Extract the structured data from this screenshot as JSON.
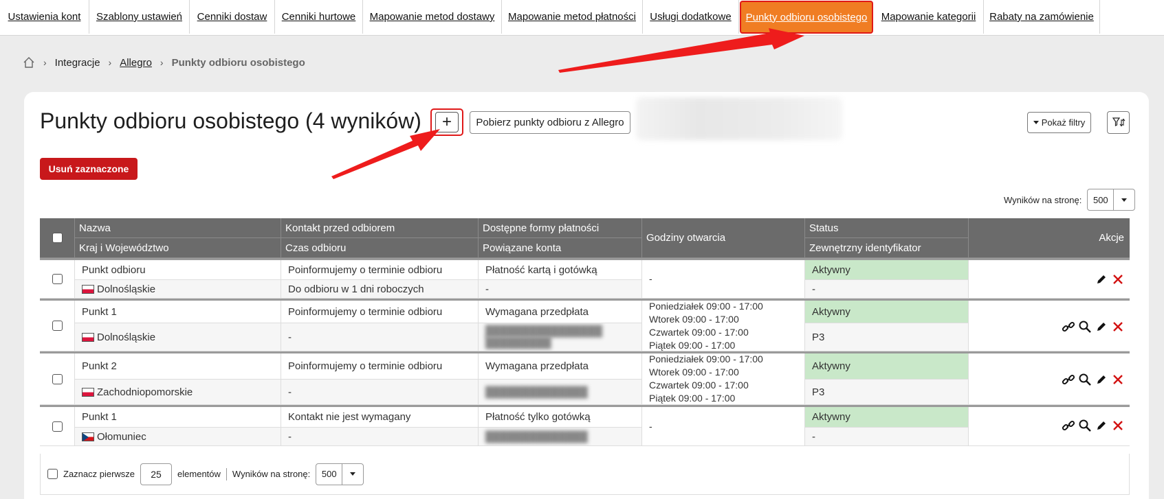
{
  "topnav": {
    "tabs": [
      {
        "label": "Ustawienia kont",
        "active": false
      },
      {
        "label": "Szablony ustawień",
        "active": false
      },
      {
        "label": "Cenniki dostaw",
        "active": false
      },
      {
        "label": "Cenniki hurtowe",
        "active": false
      },
      {
        "label": "Mapowanie metod dostawy",
        "active": false
      },
      {
        "label": "Mapowanie metod płatności",
        "active": false
      },
      {
        "label": "Usługi dodatkowe",
        "active": false
      },
      {
        "label": "Punkty odbioru osobistego",
        "active": true
      },
      {
        "label": "Mapowanie kategorii",
        "active": false
      },
      {
        "label": "Rabaty na zamówienie",
        "active": false
      }
    ]
  },
  "breadcrumb": {
    "home_icon": "home-icon",
    "items": [
      "Integracje",
      "Allegro",
      "Punkty odbioru osobistego"
    ]
  },
  "header": {
    "title": "Punkty odbioru osobistego (4 wyników)",
    "add_label": "+",
    "fetch_label": "Pobierz punkty odbioru z Allegro",
    "filters_label": "Pokaż filtry",
    "sort_icon": "filter-sort-icon"
  },
  "delete_selected_label": "Usuń zaznaczone",
  "per_page": {
    "label": "Wyników na stronę:",
    "value": "500"
  },
  "table": {
    "headers": {
      "name": "Nazwa",
      "country": "Kraj i Województwo",
      "contact": "Kontakt przed odbiorem",
      "pickup_time": "Czas odbioru",
      "payment": "Dostępne formy płatności",
      "accounts": "Powiązane konta",
      "hours": "Godziny otwarcia",
      "status": "Status",
      "external_id": "Zewnętrzny identyfikator",
      "actions": "Akcje"
    },
    "rows": [
      {
        "name": "Punkt odbioru",
        "region": "Dolnośląskie",
        "country_flag": "pl",
        "contact": "Poinformujemy o terminie odbioru",
        "pickup_time": "Do odbioru w 1 dni roboczych",
        "payment": "Płatność kartą i gotówką",
        "accounts": "-",
        "hours": [
          "-"
        ],
        "status": "Aktywny",
        "external_id": "-",
        "actions": [
          "pencil-icon",
          "delete-icon"
        ]
      },
      {
        "name": "Punkt 1",
        "region": "Dolnośląskie",
        "country_flag": "pl",
        "contact": "Poinformujemy o terminie odbioru",
        "pickup_time": "-",
        "payment": "Wymagana przedpłata",
        "accounts": "",
        "hours": [
          "Poniedziałek 09:00 - 17:00",
          "Wtorek 09:00 - 17:00",
          "Czwartek 09:00 - 17:00",
          "Piątek 09:00 - 17:00"
        ],
        "status": "Aktywny",
        "external_id": "P3",
        "actions": [
          "link-icon",
          "search-icon",
          "pencil-icon",
          "delete-icon"
        ]
      },
      {
        "name": "Punkt 2",
        "region": "Zachodniopomorskie",
        "country_flag": "pl",
        "contact": "Poinformujemy o terminie odbioru",
        "pickup_time": "-",
        "payment": "Wymagana przedpłata",
        "accounts": "",
        "hours": [
          "Poniedziałek 09:00 - 17:00",
          "Wtorek 09:00 - 17:00",
          "Czwartek 09:00 - 17:00",
          "Piątek 09:00 - 17:00"
        ],
        "status": "Aktywny",
        "external_id": "P3",
        "actions": [
          "link-icon",
          "search-icon",
          "pencil-icon",
          "delete-icon"
        ]
      },
      {
        "name": "Punkt 1",
        "region": "Ołomuniec",
        "country_flag": "cz",
        "contact": "Kontakt nie jest wymagany",
        "pickup_time": "-",
        "payment": "Płatność tylko gotówką",
        "accounts": "",
        "hours": [
          "-"
        ],
        "status": "Aktywny",
        "external_id": "-",
        "actions": [
          "link-icon",
          "search-icon",
          "pencil-icon",
          "delete-icon"
        ]
      }
    ]
  },
  "footer": {
    "select_first_label": "Zaznacz pierwsze",
    "select_first_value": "25",
    "elements_label": "elementów",
    "per_page_label": "Wyników na stronę:",
    "per_page_value": "500"
  },
  "colors": {
    "active_tab": "#f07d23",
    "highlight": "#e01818",
    "delete_button": "#c8181b",
    "table_header": "#6b6b6b",
    "status_active": "#c9e8c9"
  }
}
